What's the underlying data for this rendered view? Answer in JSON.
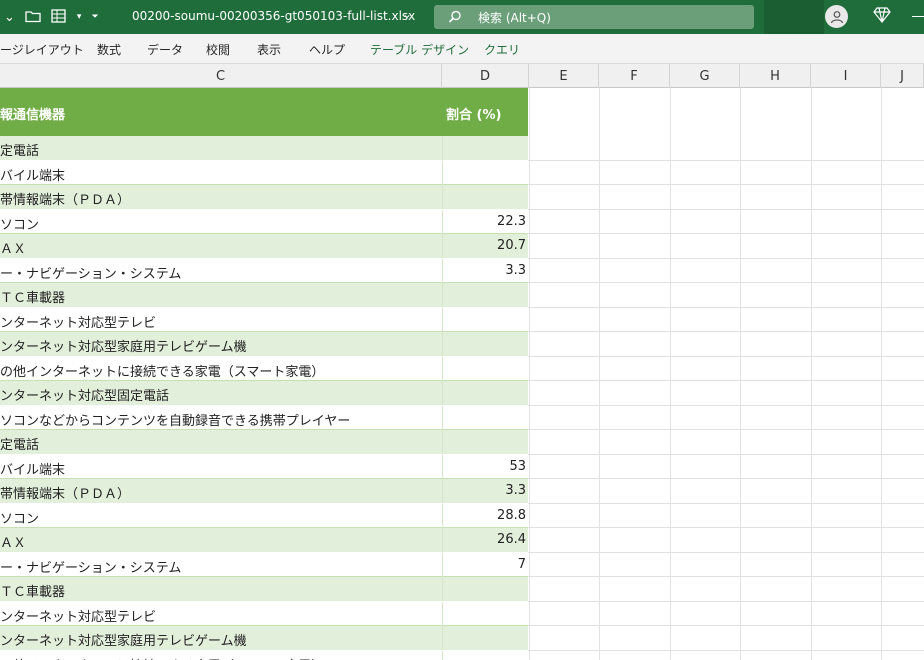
{
  "titlebar": {
    "filename": "00200-soumu-00200356-gt050103-full-list.xlsx",
    "search_placeholder": "検索 (Alt+Q)",
    "icons": [
      "chevron-down-icon",
      "folder-icon",
      "grid-icon",
      "customize-icon",
      "search-icon",
      "account-icon",
      "diamond-icon"
    ]
  },
  "ribbon": {
    "tabs": [
      "ージレイアウト",
      "数式",
      "データ",
      "校閲",
      "表示",
      "ヘルプ",
      "テーブル デザイン",
      "クエリ"
    ]
  },
  "columns": [
    "C",
    "D",
    "E",
    "F",
    "G",
    "H",
    "I",
    "J"
  ],
  "table": {
    "header_c": "報通信機器",
    "header_d": "割合 (%)",
    "rows": [
      {
        "c": "定電話",
        "d": ""
      },
      {
        "c": "バイル端末",
        "d": ""
      },
      {
        "c": "帯情報端末（ＰＤＡ）",
        "d": ""
      },
      {
        "c": "ソコン",
        "d": "22.3"
      },
      {
        "c": "ＡＸ",
        "d": "20.7"
      },
      {
        "c": "ー・ナビゲーション・システム",
        "d": "3.3"
      },
      {
        "c": "ＴＣ車載器",
        "d": ""
      },
      {
        "c": "ンターネット対応型テレビ",
        "d": ""
      },
      {
        "c": "ンターネット対応型家庭用テレビゲーム機",
        "d": ""
      },
      {
        "c": "の他インターネットに接続できる家電（スマート家電）",
        "d": ""
      },
      {
        "c": "ンターネット対応型固定電話",
        "d": ""
      },
      {
        "c": "ソコンなどからコンテンツを自動録音できる携帯プレイヤー",
        "d": ""
      },
      {
        "c": "定電話",
        "d": ""
      },
      {
        "c": "バイル端末",
        "d": "53"
      },
      {
        "c": "帯情報端末（ＰＤＡ）",
        "d": "3.3"
      },
      {
        "c": "ソコン",
        "d": "28.8"
      },
      {
        "c": "ＡＸ",
        "d": "26.4"
      },
      {
        "c": "ー・ナビゲーション・システム",
        "d": "7"
      },
      {
        "c": "ＴＣ車載器",
        "d": ""
      },
      {
        "c": "ンターネット対応型テレビ",
        "d": ""
      },
      {
        "c": "ンターネット対応型家庭用テレビゲーム機",
        "d": ""
      },
      {
        "c": "の他インターネットに接続できる家電（スマート家電）",
        "d": ""
      }
    ]
  },
  "colors": {
    "titlebar": "#1f6d3a",
    "table_header": "#70ad47",
    "band": "#e2efda"
  }
}
